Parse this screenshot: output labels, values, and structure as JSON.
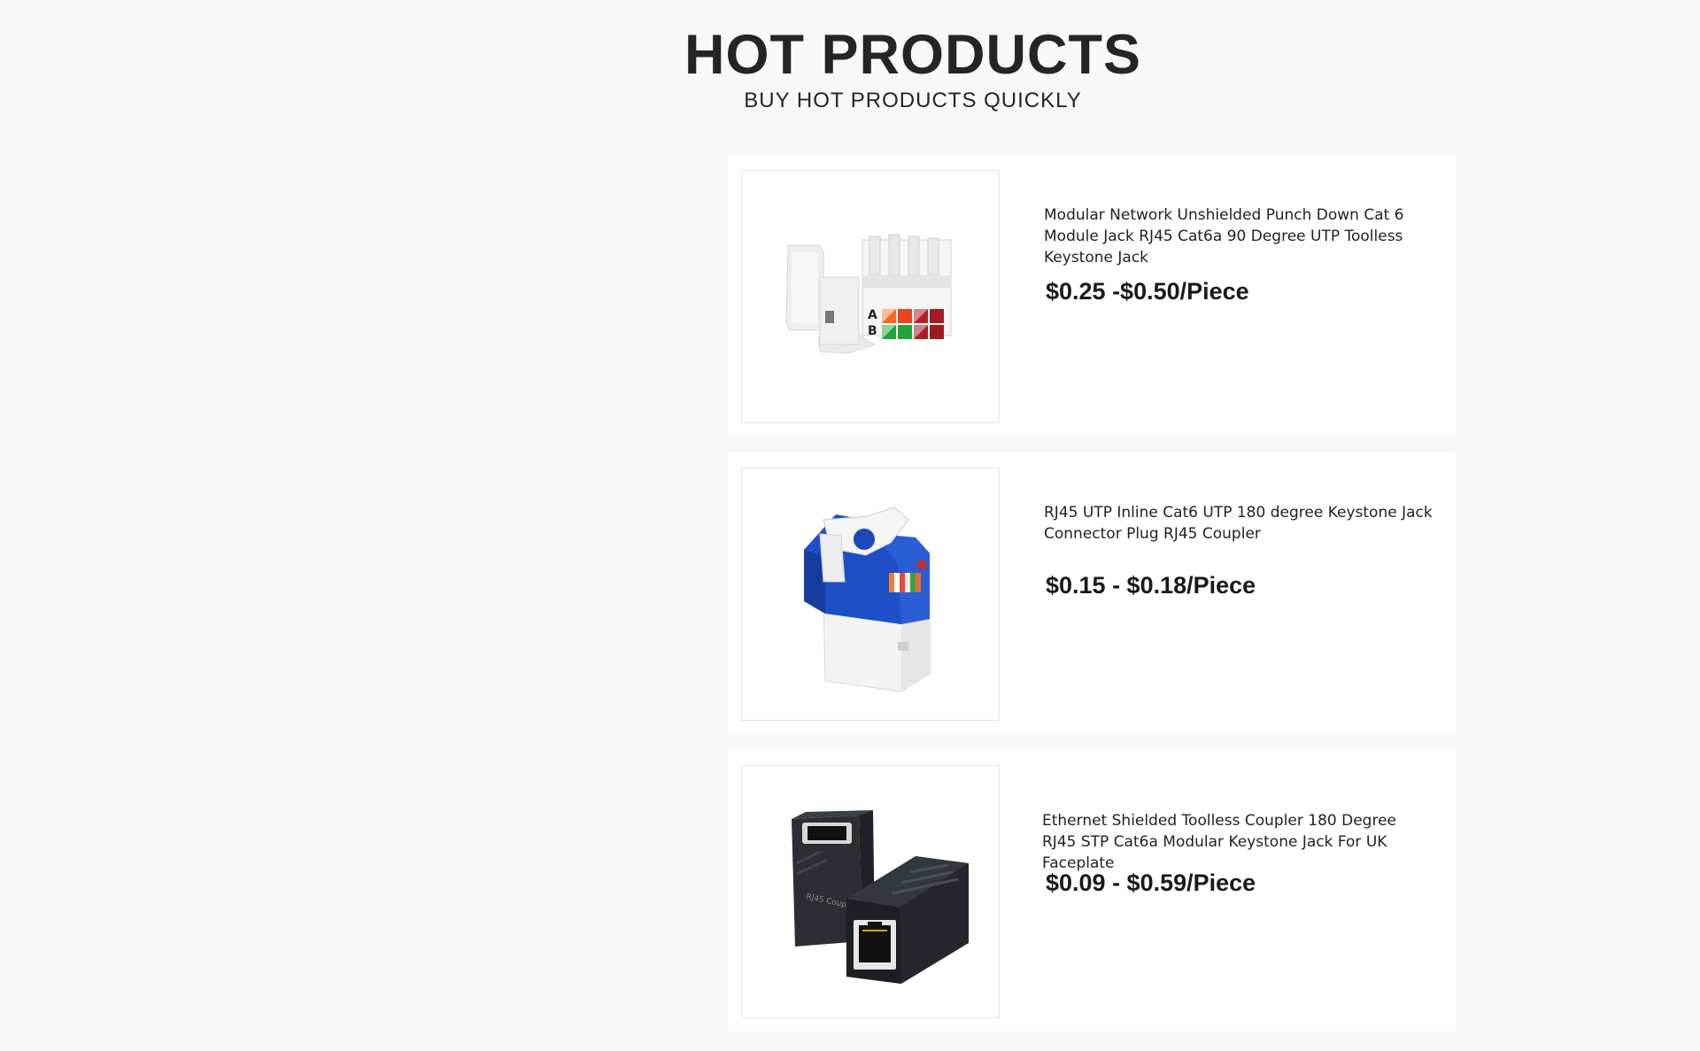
{
  "header": {
    "title": "HOT PRODUCTS",
    "subtitle": "BUY HOT PRODUCTS QUICKLY"
  },
  "products": [
    {
      "name": "Modular Network Unshielded Punch Down Cat 6 Module Jack RJ45 Cat6a 90 Degree UTP Toolless Keystone Jack",
      "price": "$0.25 -$0.50/Piece",
      "image": "white-cat6-keystone-jack-image",
      "image_labels": [
        "A",
        "B"
      ]
    },
    {
      "name": "RJ45 UTP Inline Cat6 UTP 180 degree Keystone Jack Connector Plug RJ45 Coupler",
      "price": "$0.15 - $0.18/Piece",
      "image": "blue-inline-keystone-jack-image"
    },
    {
      "name": "Ethernet Shielded Toolless Coupler 180 Degree RJ45 STP Cat6a Modular Keystone Jack For UK Faceplate",
      "price": "$0.09 - $0.59/Piece",
      "image": "black-rj45-coupler-image",
      "image_labels": [
        "RJ45 Coupler"
      ]
    }
  ]
}
